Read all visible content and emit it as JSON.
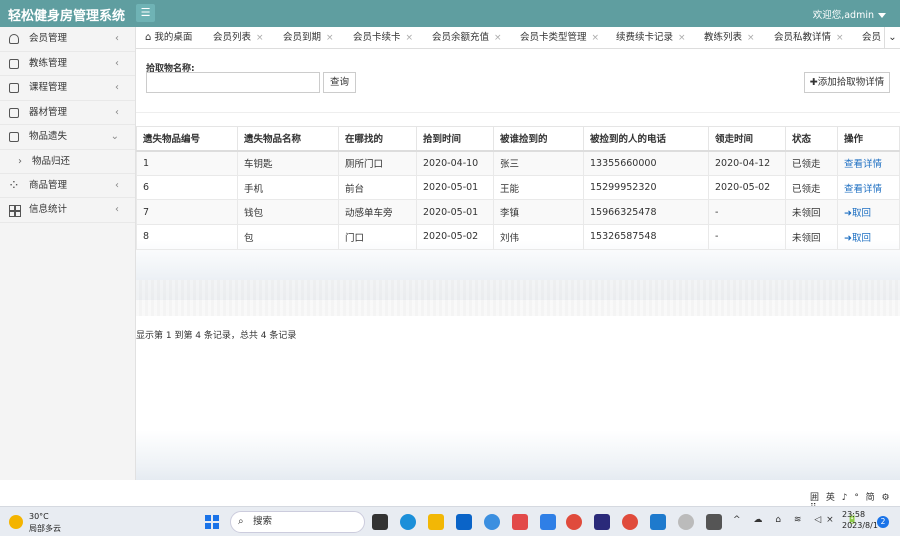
{
  "app": {
    "title": "轻松健身房管理系统",
    "menu_toggle": "☰",
    "welcome": "欢迎您,admin"
  },
  "sidebar": {
    "items": [
      {
        "label": "会员管理",
        "arrow": "‹"
      },
      {
        "label": "教练管理",
        "arrow": "‹"
      },
      {
        "label": "课程管理",
        "arrow": "‹"
      },
      {
        "label": "器材管理",
        "arrow": "‹"
      },
      {
        "label": "物品遗失",
        "arrow": "⌄"
      },
      {
        "label": "商品管理",
        "arrow": "‹"
      },
      {
        "label": "信息统计",
        "arrow": "‹"
      }
    ],
    "sub_item": {
      "label": "物品归还",
      "chevron": "›"
    }
  },
  "tabs": [
    {
      "label": "我的桌面",
      "close": ""
    },
    {
      "label": "会员列表",
      "close": "×"
    },
    {
      "label": "会员到期",
      "close": "×"
    },
    {
      "label": "会员卡续卡",
      "close": "×"
    },
    {
      "label": "会员余额充值",
      "close": "×"
    },
    {
      "label": "会员卡类型管理",
      "close": "×"
    },
    {
      "label": "续费续卡记录",
      "close": "×"
    },
    {
      "label": "教练列表",
      "close": "×"
    },
    {
      "label": "会员私教详情",
      "close": "×"
    },
    {
      "label": "会员",
      "close": ""
    }
  ],
  "tab_more": "⌄",
  "search": {
    "label": "拾取物名称:",
    "value": "",
    "placeholder": "",
    "button": "查询"
  },
  "add_button": "✚添加拾取物详情",
  "table": {
    "headers": [
      "遗失物品编号",
      "遗失物品名称",
      "在哪找的",
      "拾到时间",
      "被谁捡到的",
      "被捡到的人的电话",
      "领走时间",
      "状态",
      "操作"
    ],
    "rows": [
      {
        "id": "1",
        "name": "车钥匙",
        "where": "厕所门口",
        "found_time": "2020-04-10",
        "finder": "张三",
        "phone": "13355660000",
        "pickup_time": "2020-04-12",
        "status": "已领走",
        "action": "查看详情"
      },
      {
        "id": "6",
        "name": "手机",
        "where": "前台",
        "found_time": "2020-05-01",
        "finder": "王能",
        "phone": "15299952320",
        "pickup_time": "2020-05-02",
        "status": "已领走",
        "action": "查看详情"
      },
      {
        "id": "7",
        "name": "钱包",
        "where": "动感单车旁",
        "found_time": "2020-05-01",
        "finder": "李镇",
        "phone": "15966325478",
        "pickup_time": "-",
        "status": "未领回",
        "action": "➜取回"
      },
      {
        "id": "8",
        "name": "包",
        "where": "门口",
        "found_time": "2020-05-02",
        "finder": "刘伟",
        "phone": "15326587548",
        "pickup_time": "-",
        "status": "未领回",
        "action": "➜取回"
      }
    ]
  },
  "pager": "显示第 1 到第 4 条记录，总共 4 条记录",
  "ime": "囲 英 ♪ ° 简 ⚙ ⠿",
  "taskbar": {
    "weather_temp": "30°C",
    "weather_desc": "局部多云",
    "search": "搜索",
    "tray_icons": "^ ☁ ⌂ ≋ ◁× 🔋",
    "time": "23:58",
    "date": "2023/8/1",
    "notifications": "2"
  }
}
